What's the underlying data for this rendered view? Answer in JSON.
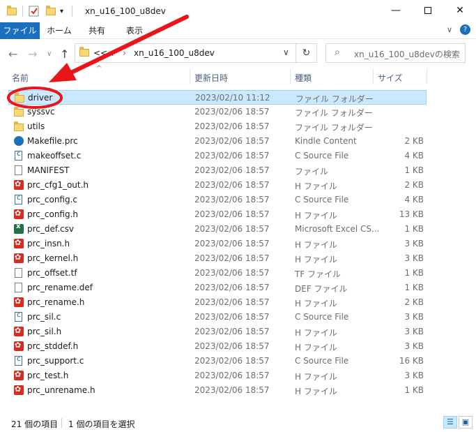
{
  "window": {
    "title": "xn_u16_100_u8dev",
    "min_icon": "minimize-icon",
    "max_icon": "maximize-icon",
    "close_icon": "close-icon"
  },
  "ribbon": {
    "tabs": [
      "ファイル",
      "ホーム",
      "共有",
      "表示"
    ],
    "accent": "#1a6fbf"
  },
  "nav": {
    "crumb_prefix": "<<",
    "crumb_hidden": "...",
    "crumb_current": "xn_u16_100_u8dev",
    "search_placeholder": "xn_u16_100_u8devの検索"
  },
  "columns": {
    "name": "名前",
    "date": "更新日時",
    "type": "種類",
    "size": "サイズ"
  },
  "files": [
    {
      "name": "driver",
      "date": "2023/02/10 11:12",
      "type": "ファイル フォルダー",
      "size": "",
      "icon": "folder",
      "selected": true
    },
    {
      "name": "syssvc",
      "date": "2023/02/06 18:57",
      "type": "ファイル フォルダー",
      "size": "",
      "icon": "folder"
    },
    {
      "name": "utils",
      "date": "2023/02/06 18:57",
      "type": "ファイル フォルダー",
      "size": "",
      "icon": "folder"
    },
    {
      "name": "Makefile.prc",
      "date": "2023/02/06 18:57",
      "type": "Kindle Content",
      "size": "2 KB",
      "icon": "kindle"
    },
    {
      "name": "makeoffset.c",
      "date": "2023/02/06 18:57",
      "type": "C Source File",
      "size": "4 KB",
      "icon": "c"
    },
    {
      "name": "MANIFEST",
      "date": "2023/02/06 18:57",
      "type": "ファイル",
      "size": "1 KB",
      "icon": "file"
    },
    {
      "name": "prc_cfg1_out.h",
      "date": "2023/02/06 18:57",
      "type": "H ファイル",
      "size": "2 KB",
      "icon": "h"
    },
    {
      "name": "prc_config.c",
      "date": "2023/02/06 18:57",
      "type": "C Source File",
      "size": "4 KB",
      "icon": "c"
    },
    {
      "name": "prc_config.h",
      "date": "2023/02/06 18:57",
      "type": "H ファイル",
      "size": "13 KB",
      "icon": "h"
    },
    {
      "name": "prc_def.csv",
      "date": "2023/02/06 18:57",
      "type": "Microsoft Excel CS...",
      "size": "1 KB",
      "icon": "excel"
    },
    {
      "name": "prc_insn.h",
      "date": "2023/02/06 18:57",
      "type": "H ファイル",
      "size": "3 KB",
      "icon": "h"
    },
    {
      "name": "prc_kernel.h",
      "date": "2023/02/06 18:57",
      "type": "H ファイル",
      "size": "3 KB",
      "icon": "h"
    },
    {
      "name": "prc_offset.tf",
      "date": "2023/02/06 18:57",
      "type": "TF ファイル",
      "size": "1 KB",
      "icon": "file"
    },
    {
      "name": "prc_rename.def",
      "date": "2023/02/06 18:57",
      "type": "DEF ファイル",
      "size": "1 KB",
      "icon": "file"
    },
    {
      "name": "prc_rename.h",
      "date": "2023/02/06 18:57",
      "type": "H ファイル",
      "size": "2 KB",
      "icon": "h"
    },
    {
      "name": "prc_sil.c",
      "date": "2023/02/06 18:57",
      "type": "C Source File",
      "size": "3 KB",
      "icon": "c"
    },
    {
      "name": "prc_sil.h",
      "date": "2023/02/06 18:57",
      "type": "H ファイル",
      "size": "3 KB",
      "icon": "h"
    },
    {
      "name": "prc_stddef.h",
      "date": "2023/02/06 18:57",
      "type": "H ファイル",
      "size": "3 KB",
      "icon": "h"
    },
    {
      "name": "prc_support.c",
      "date": "2023/02/06 18:57",
      "type": "C Source File",
      "size": "16 KB",
      "icon": "c"
    },
    {
      "name": "prc_test.h",
      "date": "2023/02/06 18:57",
      "type": "H ファイル",
      "size": "3 KB",
      "icon": "h"
    },
    {
      "name": "prc_unrename.h",
      "date": "2023/02/06 18:57",
      "type": "H ファイル",
      "size": "1 KB",
      "icon": "h"
    }
  ],
  "status": {
    "count": "21 個の項目",
    "selected": "1 個の項目を選択"
  },
  "annotation": {
    "color": "#e8161b",
    "shape": "arrow-and-circle"
  }
}
